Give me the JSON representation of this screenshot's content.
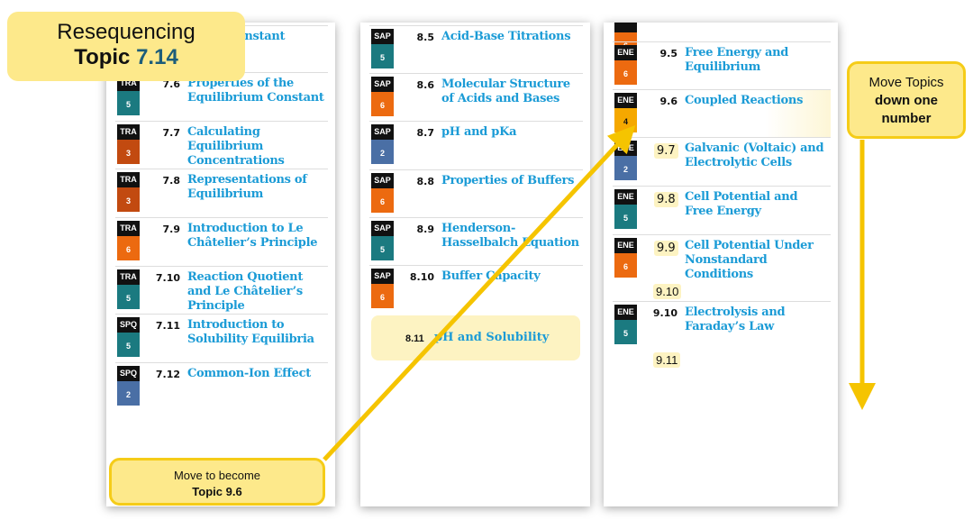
{
  "callouts": {
    "top": {
      "line1": "Resequencing",
      "line2_prefix": "Topic ",
      "line2_number": "7.14"
    },
    "right": {
      "line1": "Move Topics",
      "line2": "down one",
      "line3": "number"
    },
    "bottom": {
      "line1": "Move to become",
      "line2": "Topic 9.6"
    }
  },
  "colors": {
    "teal": "#1b7a80",
    "orange": "#ec6a10",
    "brown": "#c24a10",
    "blue": "#4a6fa5",
    "amber": "#f5a800",
    "accent": "#1b9bd6",
    "highlight": "#fde98b"
  },
  "columns": [
    {
      "rows": [
        {
          "unit": "",
          "level": "",
          "num": "",
          "title": "of the\n  Constant",
          "color": "teal"
        },
        {
          "unit": "TRA",
          "level": "5",
          "num": "7.6",
          "title": "Properties of the Equilibrium Constant",
          "color": "teal"
        },
        {
          "unit": "TRA",
          "level": "3",
          "num": "7.7",
          "title": "Calculating Equilibrium Concentrations",
          "color": "brown"
        },
        {
          "unit": "TRA",
          "level": "3",
          "num": "7.8",
          "title": "Representations of Equilibrium",
          "color": "brown"
        },
        {
          "unit": "TRA",
          "level": "6",
          "num": "7.9",
          "title": "Introduction to Le Châtelier’s Principle",
          "color": "orange"
        },
        {
          "unit": "TRA",
          "level": "5",
          "num": "7.10",
          "title": "Reaction Quotient and Le Châtelier’s Principle",
          "color": "teal"
        },
        {
          "unit": "SPQ",
          "level": "5",
          "num": "7.11",
          "title": "Introduction to Solubility Equilibria",
          "color": "teal"
        },
        {
          "unit": "SPQ",
          "level": "2",
          "num": "7.12",
          "title": "Common-Ion Effect",
          "color": "blue"
        }
      ]
    },
    {
      "rows": [
        {
          "unit": "SAP",
          "level": "5",
          "num": "8.5",
          "title": "Acid-Base Titrations",
          "color": "teal"
        },
        {
          "unit": "SAP",
          "level": "6",
          "num": "8.6",
          "title": "Molecular Structure of Acids and Bases",
          "color": "orange"
        },
        {
          "unit": "SAP",
          "level": "2",
          "num": "8.7",
          "title": "pH and pKa",
          "color": "blue"
        },
        {
          "unit": "SAP",
          "level": "6",
          "num": "8.8",
          "title": "Properties of Buffers",
          "color": "orange"
        },
        {
          "unit": "SAP",
          "level": "5",
          "num": "8.9",
          "title": "Henderson-Hasselbalch Equation",
          "color": "teal"
        },
        {
          "unit": "SAP",
          "level": "6",
          "num": "8.10",
          "title": "Buffer Capacity",
          "color": "orange"
        }
      ],
      "moved": {
        "num": "8.11",
        "title": "pH and Solubility"
      }
    },
    {
      "rows": [
        {
          "unit": "",
          "level": "6",
          "num": "",
          "title": "",
          "color": "orange"
        },
        {
          "unit": "ENE",
          "level": "6",
          "num": "9.5",
          "title": "Free Energy and Equilibrium",
          "color": "orange"
        },
        {
          "unit": "ENE",
          "level": "4",
          "num": "9.6",
          "title": "Coupled Reactions",
          "color": "amber"
        },
        {
          "unit": "ENE",
          "level": "2",
          "num": "9.7",
          "title": "Galvanic (Voltaic) and Electrolytic Cells",
          "color": "blue",
          "new": true
        },
        {
          "unit": "ENE",
          "level": "5",
          "num": "9.8",
          "title": "Cell Potential and Free Energy",
          "color": "teal",
          "new": true
        },
        {
          "unit": "ENE",
          "level": "6",
          "num": "9.9",
          "title": "Cell Potential Under Nonstandard Conditions",
          "color": "orange",
          "new": true,
          "extra": "9.10"
        },
        {
          "unit": "ENE",
          "level": "5",
          "num": "9.10",
          "title": "Electrolysis and Faraday’s Law",
          "color": "teal",
          "extra": "9.11"
        }
      ]
    }
  ]
}
